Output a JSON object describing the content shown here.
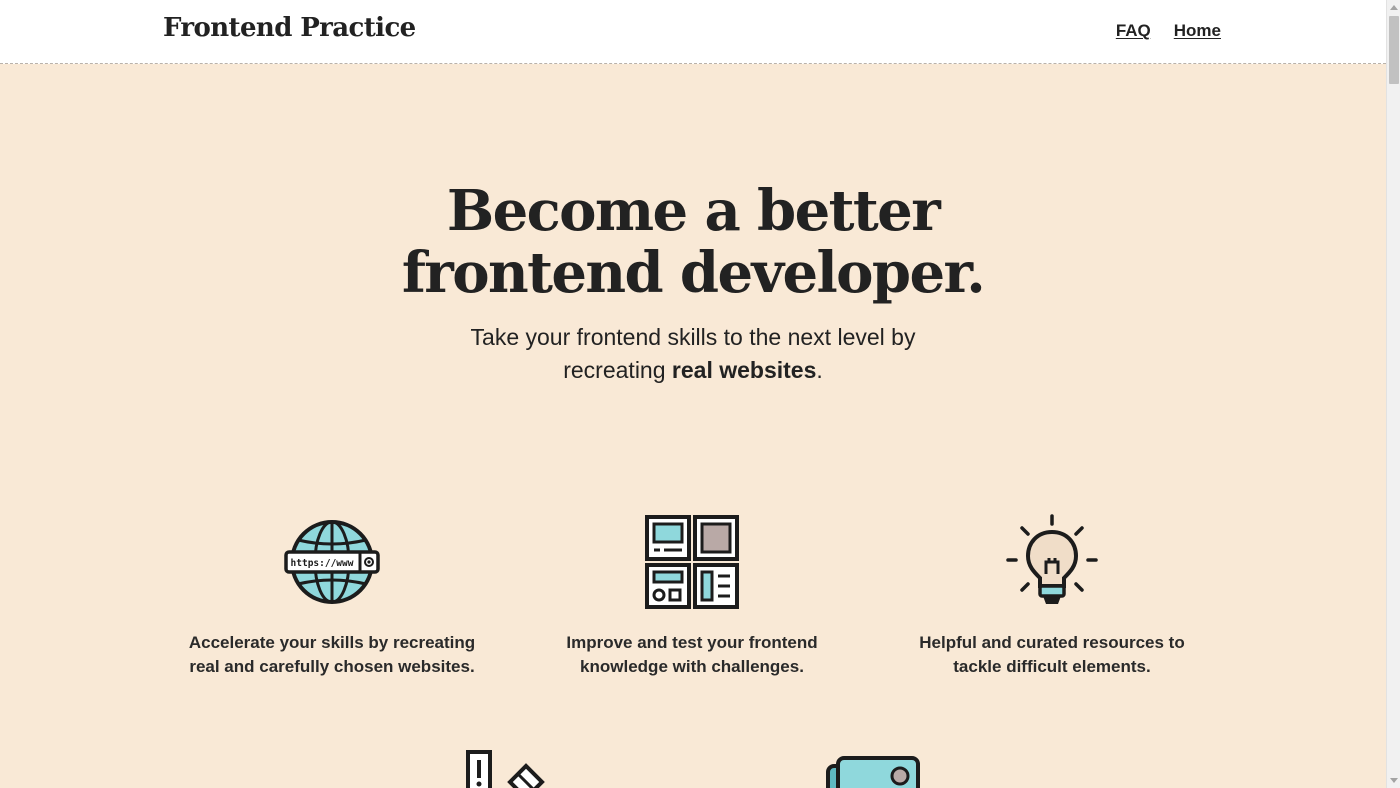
{
  "header": {
    "brand": "Frontend Practice",
    "nav": [
      {
        "label": "FAQ"
      },
      {
        "label": "Home"
      }
    ]
  },
  "hero": {
    "title_line1": "Become a better",
    "title_line2": "frontend developer.",
    "subtitle_line1": "Take your frontend skills to the next level by",
    "subtitle_line2_prefix": "recreating ",
    "subtitle_line2_bold": "real websites",
    "subtitle_line2_suffix": "."
  },
  "features": [
    {
      "icon": "globe-icon",
      "icon_label": "https://www",
      "line1": "Accelerate your skills by recreating",
      "line2": "real and carefully chosen websites."
    },
    {
      "icon": "layout-grid-icon",
      "line1": "Improve and test your frontend",
      "line2": "knowledge with challenges."
    },
    {
      "icon": "lightbulb-icon",
      "line1": "Helpful and curated resources to",
      "line2": "tackle difficult elements."
    }
  ],
  "below_fold_icons": [
    "ruler-pencil-icon",
    "image-icon"
  ],
  "colors": {
    "background": "#f9e9d6",
    "header_background": "#ffffff",
    "text": "#222222",
    "icon_accent": "#8fd8dc"
  }
}
